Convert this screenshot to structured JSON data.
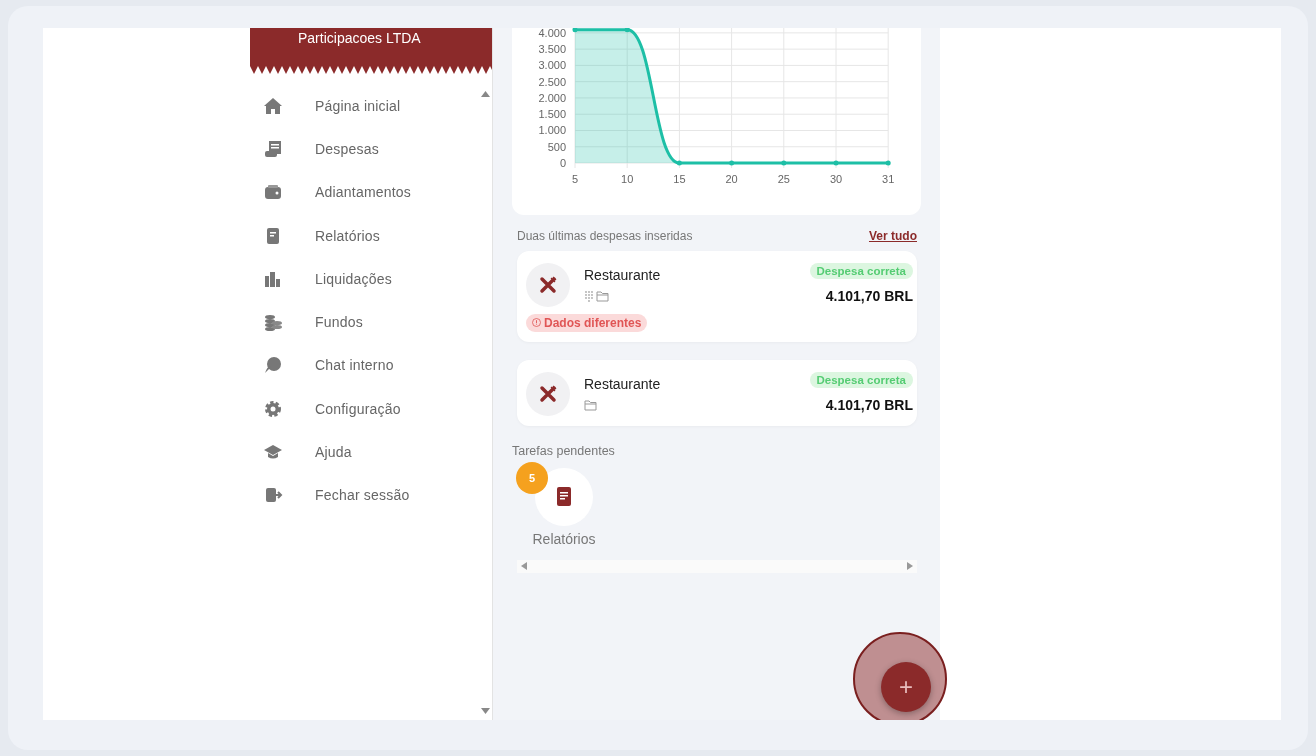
{
  "sidebar": {
    "company": "Participacoes LTDA",
    "items": [
      {
        "label": "Página inicial"
      },
      {
        "label": "Despesas"
      },
      {
        "label": "Adiantamentos"
      },
      {
        "label": "Relatórios"
      },
      {
        "label": "Liquidações"
      },
      {
        "label": "Fundos"
      },
      {
        "label": "Chat interno"
      },
      {
        "label": "Configuração"
      },
      {
        "label": "Ajuda"
      },
      {
        "label": "Fechar sessão"
      }
    ]
  },
  "chart": {
    "chart_data": {
      "type": "area",
      "categories": [
        "5",
        "10",
        "15",
        "20",
        "25",
        "30",
        "31"
      ],
      "series": [
        {
          "color": "#1dbfa6",
          "values": [
            4100,
            4100,
            0,
            0,
            0,
            0,
            0
          ]
        }
      ],
      "grid": true,
      "ylim": [
        0,
        4150
      ],
      "yticks": [
        {
          "value": 0,
          "label": "0"
        },
        {
          "value": 500,
          "label": "500"
        },
        {
          "value": 1000,
          "label": "1.000"
        },
        {
          "value": 1500,
          "label": "1.500"
        },
        {
          "value": 2000,
          "label": "2.000"
        },
        {
          "value": 2500,
          "label": "2.500"
        },
        {
          "value": 3000,
          "label": "3.000"
        },
        {
          "value": 3500,
          "label": "3.500"
        },
        {
          "value": 4000,
          "label": "4.000"
        }
      ]
    }
  },
  "recent": {
    "title": "Duas últimas despesas inseridas",
    "link": "Ver tudo",
    "expenses": [
      {
        "name": "Restaurante",
        "status": "Despesa correta",
        "amount": "4.101,70 BRL",
        "grid_icon": true,
        "warning": "Dados diferentes"
      },
      {
        "name": "Restaurante",
        "status": "Despesa correta",
        "amount": "4.101,70 BRL",
        "grid_icon": false
      }
    ]
  },
  "pending": {
    "title": "Tarefas pendentes",
    "tasks": [
      {
        "label": "Relatórios",
        "count": "5"
      }
    ]
  },
  "fab": {
    "label": "+",
    "highlighted": true
  }
}
